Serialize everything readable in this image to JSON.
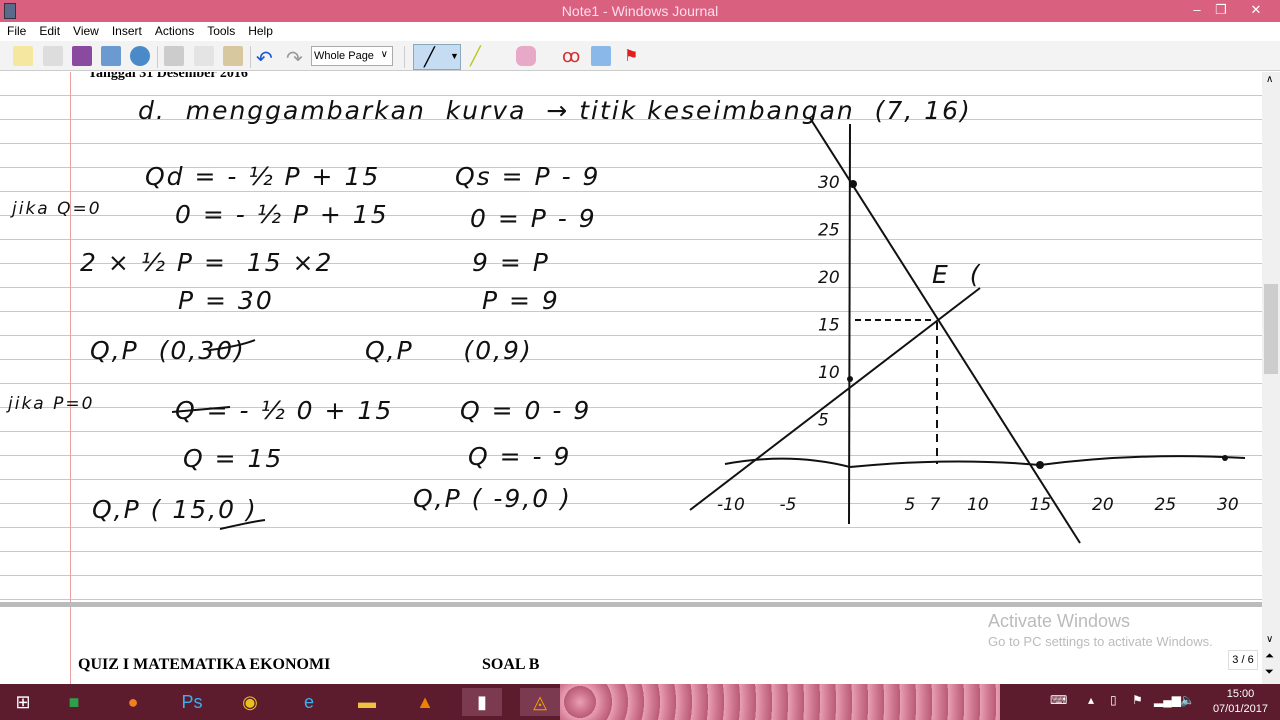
{
  "window": {
    "title": "Note1 - Windows Journal",
    "minimize": "–",
    "maximize": "❐",
    "close": "✕"
  },
  "menu": [
    "File",
    "Edit",
    "View",
    "Insert",
    "Actions",
    "Tools",
    "Help"
  ],
  "toolbar": {
    "zoom_value": "Whole Page",
    "icons": [
      "new-note-icon",
      "note-from-template-icon",
      "save-icon",
      "send-icon",
      "find-icon",
      "cut-icon",
      "copy-icon",
      "paste-icon",
      "undo-icon",
      "redo-icon",
      "pen-icon",
      "highlighter-icon",
      "eraser-icon",
      "lasso-icon",
      "insert-space-icon",
      "flag-icon"
    ]
  },
  "page": {
    "header": "Tanggal 31 Desember 2016",
    "notes": {
      "heading": "d.  menggambarkan  kurva  → titik keseimbangan  (7, 16)",
      "jika_q": "jika Q=0",
      "jika_p": "jika P=0",
      "l1": "Qd = - ½ P + 15",
      "l2": "0 = - ½ P + 15",
      "l3": "2 × ½ P =  15 ×2",
      "l4": "P = 30",
      "l5": "Q,P  (0,30)",
      "l6": "Q = - ½ 0 + 15",
      "l7": "Q = 15",
      "l8": "Q,P ( 15,0 )",
      "r1": "Qs = P - 9",
      "r2": "0 = P - 9",
      "r3": "9 = P",
      "r4": "P = 9",
      "r5": "Q,P     (0,9)",
      "r6": "Q = 0 - 9",
      "r7": "Q = - 9",
      "r8": "Q,P ( -9,0 )",
      "graph_label": "E  (",
      "y_ticks": [
        "30",
        "25",
        "20",
        "15",
        "10",
        "5"
      ],
      "x_ticks": [
        "-10",
        "-5",
        "5",
        "7",
        "10",
        "15",
        "20",
        "25",
        "30"
      ]
    }
  },
  "page2": {
    "left": "QUIZ  I MATEMATIKA EKONOMI",
    "right": "SOAL B"
  },
  "watermark": {
    "line1": "Activate Windows",
    "line2": "Go to PC settings to activate Windows."
  },
  "page_indicator": "3 / 6",
  "taskbar": {
    "apps": [
      "start-icon",
      "excel-icon",
      "firefox-icon",
      "photoshop-icon",
      "chrome-icon",
      "ie-icon",
      "explorer-icon",
      "vlc-icon",
      "journal-icon",
      "avast-icon"
    ],
    "time": "15:00",
    "date": "07/01/2017"
  }
}
